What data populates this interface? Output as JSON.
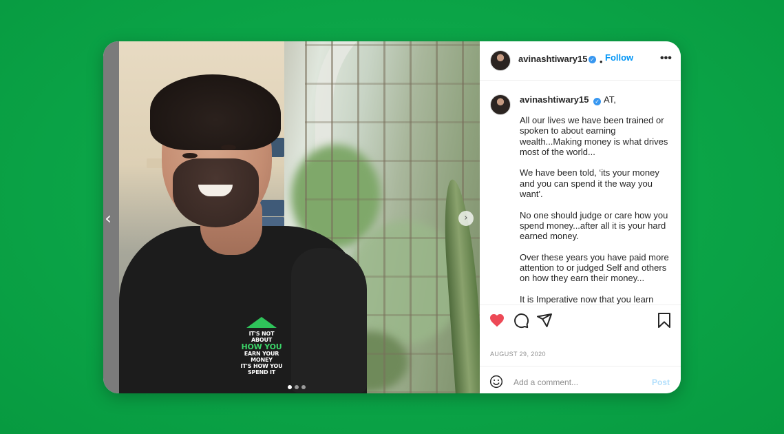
{
  "post": {
    "author": {
      "username": "avinashtiwary15",
      "verified": true,
      "verified_icon": "verified-badge-icon"
    },
    "header": {
      "separator": "•",
      "follow_label": "Follow",
      "more_icon": "more-options-icon",
      "more_label": "•••"
    },
    "media": {
      "prev_icon": "chevron-left-icon",
      "next_icon": "chevron-right-icon",
      "prev_glyph": "‹",
      "next_glyph": "›",
      "shirt_print": [
        "IT'S NOT ABOUT",
        "HOW YOU",
        "EARN YOUR MONEY",
        "IT'S HOW YOU",
        "SPEND IT"
      ],
      "carousel_count": 3,
      "carousel_active_index": 0
    },
    "caption": {
      "username": "avinashtiwary15",
      "first_line": " AT,",
      "paragraphs": [
        "All our lives we have been trained or spoken to about earning wealth...Making money is what drives most of the world...",
        "We have been told, ‘its your money and you can spend it the way you want'.",
        "No one should judge or care how you spend money...after all it is your hard earned money.",
        "Over these years you have paid more attention to or judged Self and others on how they earn their money...",
        "It is Imperative now that you learn"
      ]
    },
    "actions": {
      "like_icon": "heart-filled-icon",
      "comment_icon": "comment-icon",
      "share_icon": "share-paper-plane-icon",
      "save_icon": "bookmark-icon",
      "liked": true,
      "like_color": "#ed4956"
    },
    "date": "AUGUST 29, 2020",
    "comment_box": {
      "emoji_icon": "emoji-smiley-icon",
      "placeholder": "Add a comment...",
      "post_label": "Post"
    }
  },
  "colors": {
    "background": "#0ba447",
    "link_blue": "#0095f6",
    "post_disabled": "#b2dffc"
  }
}
